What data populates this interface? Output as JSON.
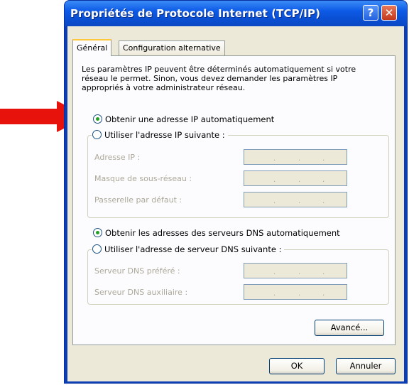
{
  "window": {
    "title": "Propriétés de Protocole Internet (TCP/IP)"
  },
  "titlebar": {
    "help": "?",
    "close": "✕"
  },
  "tabs": [
    {
      "label": "Général"
    },
    {
      "label": "Configuration alternative"
    }
  ],
  "intro": "Les paramètres IP peuvent être déterminés automatiquement si votre réseau le permet. Sinon, vous devez demander les paramètres IP appropriés à votre administrateur réseau.",
  "ip": {
    "auto_label": "Obtenir une adresse IP automatiquement",
    "manual_label": "Utiliser l'adresse IP suivante :",
    "fields": [
      {
        "label": "Adresse IP :"
      },
      {
        "label": "Masque de sous-réseau :"
      },
      {
        "label": "Passerelle par défaut :"
      }
    ]
  },
  "dns": {
    "auto_label": "Obtenir les adresses des serveurs DNS automatiquement",
    "manual_label": "Utiliser l'adresse de serveur DNS suivante :",
    "fields": [
      {
        "label": "Serveur DNS préféré :"
      },
      {
        "label": "Serveur DNS auxiliaire :"
      }
    ]
  },
  "buttons": {
    "advanced": "Avancé...",
    "ok": "OK",
    "cancel": "Annuler"
  },
  "colors": {
    "titlebar": "#0a54e3",
    "arrow": "#e8120c",
    "radio_selected": "#21a121"
  }
}
